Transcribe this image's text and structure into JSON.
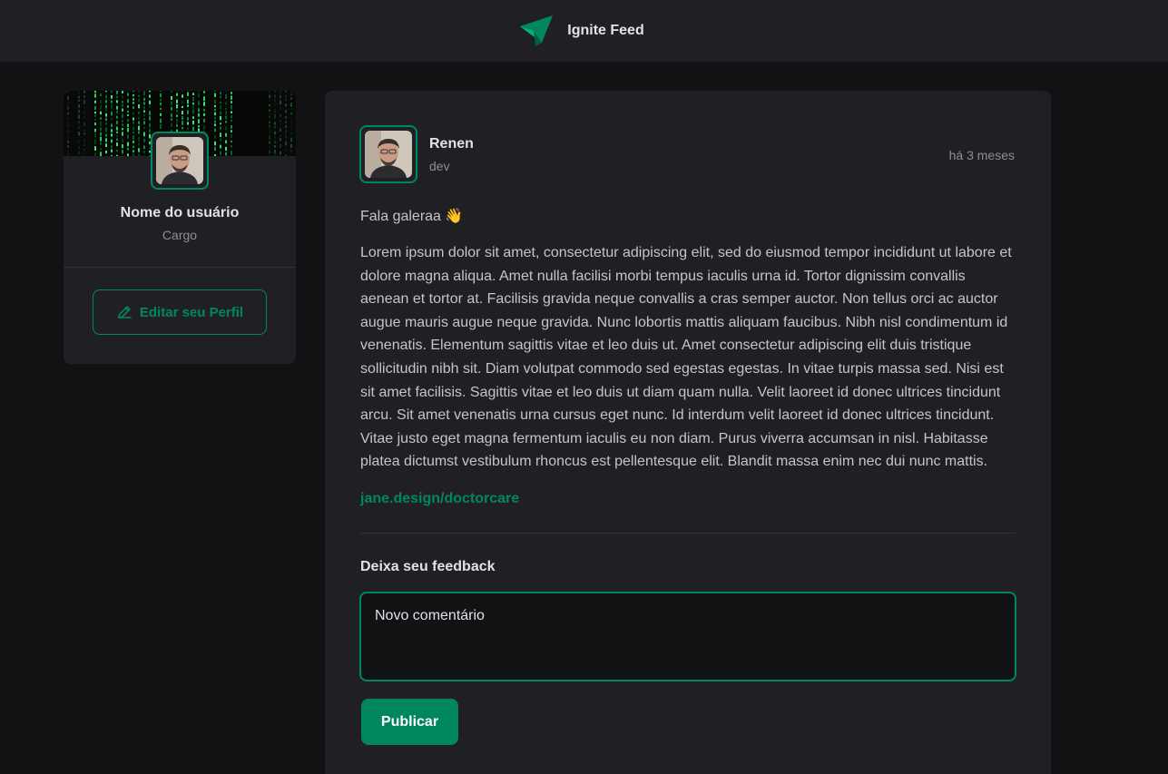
{
  "header": {
    "brand": "Ignite Feed",
    "logo_icon": "ignite-logo-icon"
  },
  "sidebar": {
    "user_name": "Nome do usuário",
    "role": "Cargo",
    "edit_button_label": "Editar seu Perfil",
    "edit_icon": "pencil-icon"
  },
  "post": {
    "author_name": "Renen",
    "author_role": "dev",
    "published_ago": "há 3 meses",
    "greeting": "Fala galeraa 👋",
    "body": "Lorem ipsum dolor sit amet, consectetur adipiscing elit, sed do eiusmod tempor incididunt ut labore et dolore magna aliqua. Amet nulla facilisi morbi tempus iaculis urna id. Tortor dignissim convallis aenean et tortor at. Facilisis gravida neque convallis a cras semper auctor. Non tellus orci ac auctor augue mauris augue neque gravida. Nunc lobortis mattis aliquam faucibus. Nibh nisl condimentum id venenatis. Elementum sagittis vitae et leo duis ut. Amet consectetur adipiscing elit duis tristique sollicitudin nibh sit. Diam volutpat commodo sed egestas egestas. In vitae turpis massa sed. Nisi est sit amet facilisis. Sagittis vitae et leo duis ut diam quam nulla. Velit laoreet id donec ultrices tincidunt arcu. Sit amet venenatis urna cursus eget nunc. Id interdum velit laoreet id donec ultrices tincidunt. Vitae justo eget magna fermentum iaculis eu non diam. Purus viverra accumsan in nisl. Habitasse platea dictumst vestibulum rhoncus est pellentesque elit. Blandit massa enim nec dui nunc mattis.",
    "link": "jane.design/doctorcare"
  },
  "comment_form": {
    "label": "Deixa seu feedback",
    "placeholder": "Novo comentário",
    "value": "",
    "submit_label": "Publicar"
  },
  "colors": {
    "accent": "#00875f",
    "background": "#121214",
    "surface": "#202024"
  }
}
